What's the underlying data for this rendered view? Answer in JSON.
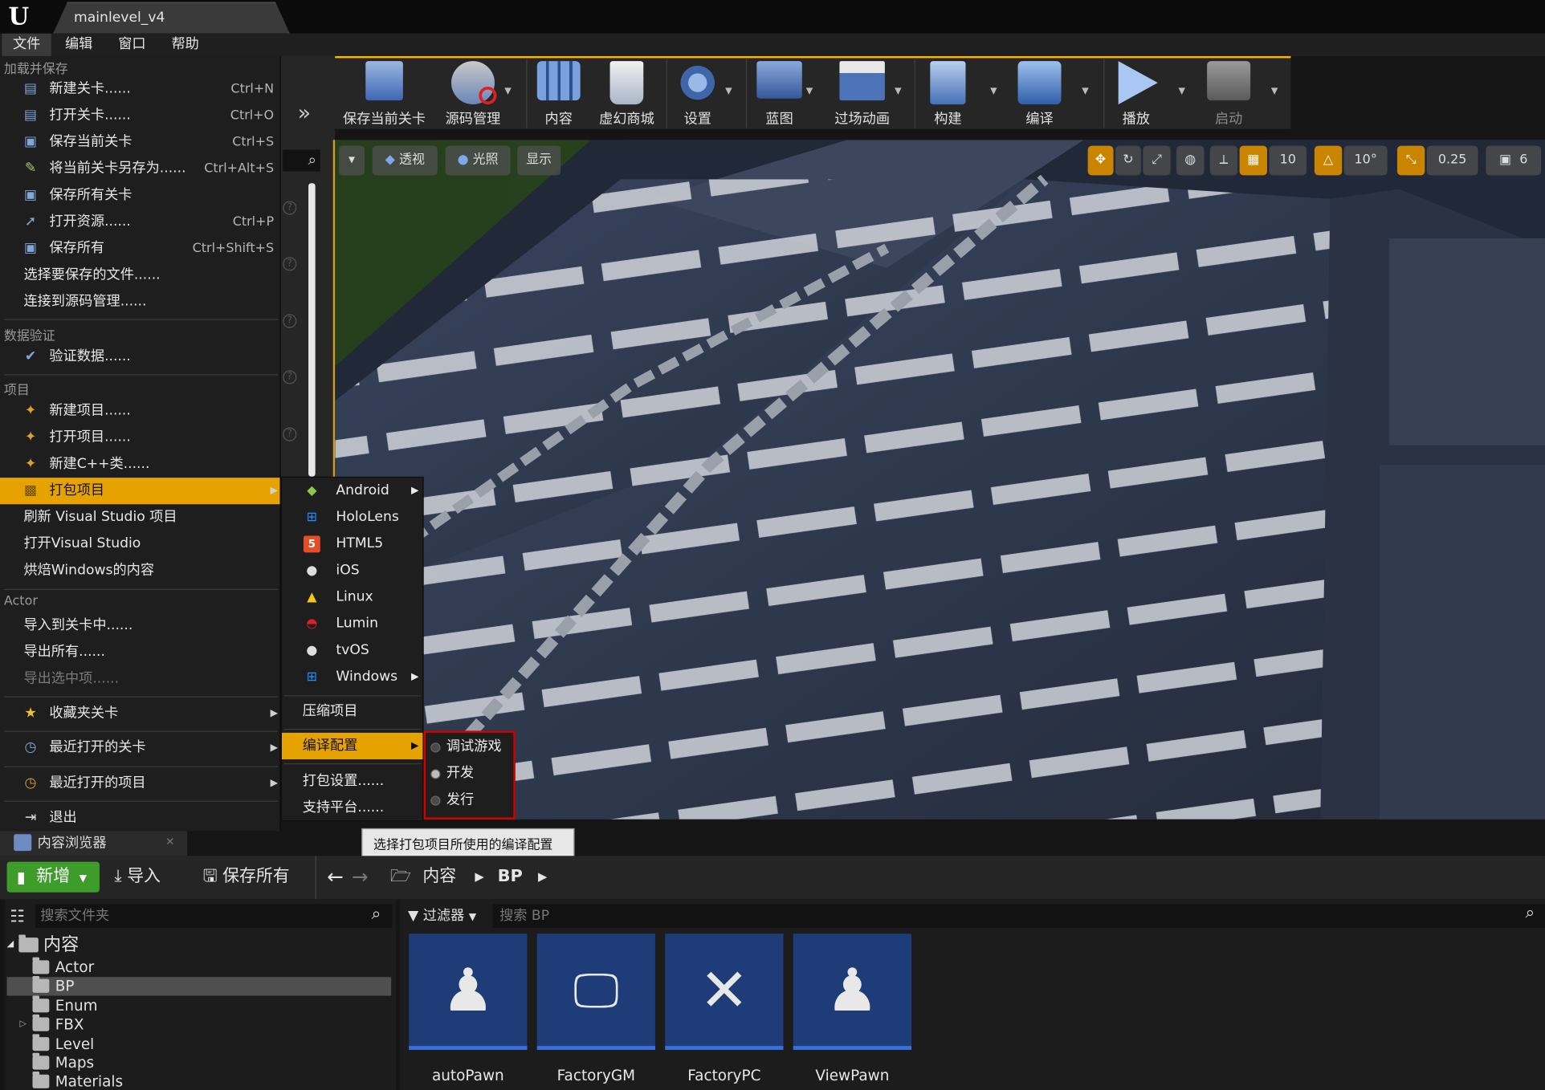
{
  "titlebar": {
    "logo_text": "U",
    "tab_title": "mainlevel_v4"
  },
  "menubar": {
    "items": [
      "文件",
      "编辑",
      "窗口",
      "帮助"
    ]
  },
  "file_menu": {
    "sections": {
      "load_save": "加载并保存",
      "data_validation": "数据验证",
      "project": "项目",
      "actor": "Actor"
    },
    "items": [
      {
        "label": "新建关卡......",
        "shortcut": "Ctrl+N",
        "icon": "new-level-icon"
      },
      {
        "label": "打开关卡......",
        "shortcut": "Ctrl+O",
        "icon": "open-level-icon"
      },
      {
        "label": "保存当前关卡",
        "shortcut": "Ctrl+S",
        "icon": "save-icon"
      },
      {
        "label": "将当前关卡另存为......",
        "shortcut": "Ctrl+Alt+S",
        "icon": "save-as-icon"
      },
      {
        "label": "保存所有关卡",
        "shortcut": "",
        "icon": "save-all-icon"
      },
      {
        "label": "打开资源......",
        "shortcut": "Ctrl+P",
        "icon": "open-asset-icon"
      },
      {
        "label": "保存所有",
        "shortcut": "Ctrl+Shift+S",
        "icon": "save-icon"
      },
      {
        "label": "选择要保存的文件......",
        "shortcut": ""
      },
      {
        "label": "连接到源码管理......",
        "shortcut": ""
      },
      {
        "label": "验证数据......",
        "icon": "validate-icon"
      },
      {
        "label": "新建项目......",
        "icon": "new-project-icon"
      },
      {
        "label": "打开项目......",
        "icon": "open-project-icon"
      },
      {
        "label": "新建C++类......",
        "icon": "new-class-icon"
      },
      {
        "label": "打包项目",
        "icon": "package-icon"
      },
      {
        "label": "刷新 Visual Studio 项目"
      },
      {
        "label": "打开Visual Studio"
      },
      {
        "label": "烘焙Windows的内容"
      },
      {
        "label": "导入到关卡中......"
      },
      {
        "label": "导出所有......"
      },
      {
        "label": "导出选中项......"
      },
      {
        "label": "收藏夹关卡",
        "icon": "star-icon"
      },
      {
        "label": "最近打开的关卡",
        "icon": "recent-levels-icon"
      },
      {
        "label": "最近打开的项目",
        "icon": "recent-projects-icon"
      },
      {
        "label": "退出",
        "icon": "exit-icon"
      }
    ]
  },
  "package_submenu": {
    "platforms": [
      {
        "label": "Android",
        "icon": "android-icon",
        "color": "#8cc84b",
        "has_sub": true
      },
      {
        "label": "HoloLens",
        "icon": "windows-icon",
        "color": "#1e90ff"
      },
      {
        "label": "HTML5",
        "icon": "html5-icon",
        "color": "#e44d26"
      },
      {
        "label": "iOS",
        "icon": "apple-icon",
        "color": "#dddddd"
      },
      {
        "label": "Linux",
        "icon": "tux-icon",
        "color": "#f5c518"
      },
      {
        "label": "Lumin",
        "icon": "lumin-icon",
        "color": "#e02020"
      },
      {
        "label": "tvOS",
        "icon": "apple-tv-icon",
        "color": "#dddddd"
      },
      {
        "label": "Windows",
        "icon": "windows-icon",
        "color": "#1e90ff",
        "has_sub": true
      }
    ],
    "compress": "压缩项目",
    "build_config": "编译配置",
    "package_settings": "打包设置......",
    "supported_platforms": "支持平台......"
  },
  "build_config_submenu": {
    "options": [
      {
        "label": "调试游戏",
        "selected": false
      },
      {
        "label": "开发",
        "selected": true
      },
      {
        "label": "发行",
        "selected": false
      }
    ]
  },
  "tooltip": "选择打包项目所使用的编译配置",
  "toolbar": {
    "buttons": [
      {
        "label": "保存当前关卡",
        "icon": "save-current-level-icon",
        "dropdown": false
      },
      {
        "label": "源码管理",
        "icon": "source-control-icon",
        "dropdown": true
      },
      {
        "label": "内容",
        "icon": "content-grid-icon",
        "dropdown": false
      },
      {
        "label": "虚幻商城",
        "icon": "marketplace-bag-icon",
        "dropdown": false
      },
      {
        "label": "设置",
        "icon": "settings-gears-icon",
        "dropdown": true
      },
      {
        "label": "蓝图",
        "icon": "blueprint-icon",
        "dropdown": true
      },
      {
        "label": "过场动画",
        "icon": "clapperboard-icon",
        "dropdown": true
      },
      {
        "label": "构建",
        "icon": "build-icon",
        "dropdown": true
      },
      {
        "label": "编译",
        "icon": "compile-icon",
        "dropdown": true
      },
      {
        "label": "播放",
        "icon": "play-icon",
        "dropdown": true
      },
      {
        "label": "启动",
        "icon": "launch-icon",
        "dropdown": true
      }
    ]
  },
  "viewport": {
    "left_buttons": [
      {
        "label": "",
        "icon": "viewport-options-icon"
      },
      {
        "label": "透视",
        "icon": "perspective-icon"
      },
      {
        "label": "光照",
        "icon": "lit-icon"
      },
      {
        "label": "显示",
        "icon": "show-icon"
      }
    ],
    "grid_snap": "10",
    "rotation_snap": "10°",
    "scale_snap": "0.25",
    "camera_speed": "6"
  },
  "content_browser": {
    "tab_title": "内容浏览器",
    "new_button": "新增",
    "import_button": "导入",
    "save_all_button": "保存所有",
    "breadcrumb": [
      "内容",
      "BP"
    ],
    "search_folders_placeholder": "搜索文件夹",
    "filter_label": "过滤器",
    "search_assets_placeholder": "搜索 BP",
    "tree": {
      "root": "内容",
      "folders": [
        "Actor",
        "BP",
        "Enum",
        "FBX",
        "Level",
        "Maps",
        "Materials"
      ],
      "selected": "BP"
    },
    "assets": [
      {
        "name": "autoPawn",
        "icon": "pawn-icon"
      },
      {
        "name": "FactoryGM",
        "icon": "gamemode-icon"
      },
      {
        "name": "FactoryPC",
        "icon": "player-controller-icon"
      },
      {
        "name": "ViewPawn",
        "icon": "pawn-icon"
      }
    ]
  },
  "colors": {
    "accent": "#e6a300",
    "highlight_border": "#d40000",
    "new_button": "#3e9c2b",
    "asset_tile": "#1d3c78"
  }
}
